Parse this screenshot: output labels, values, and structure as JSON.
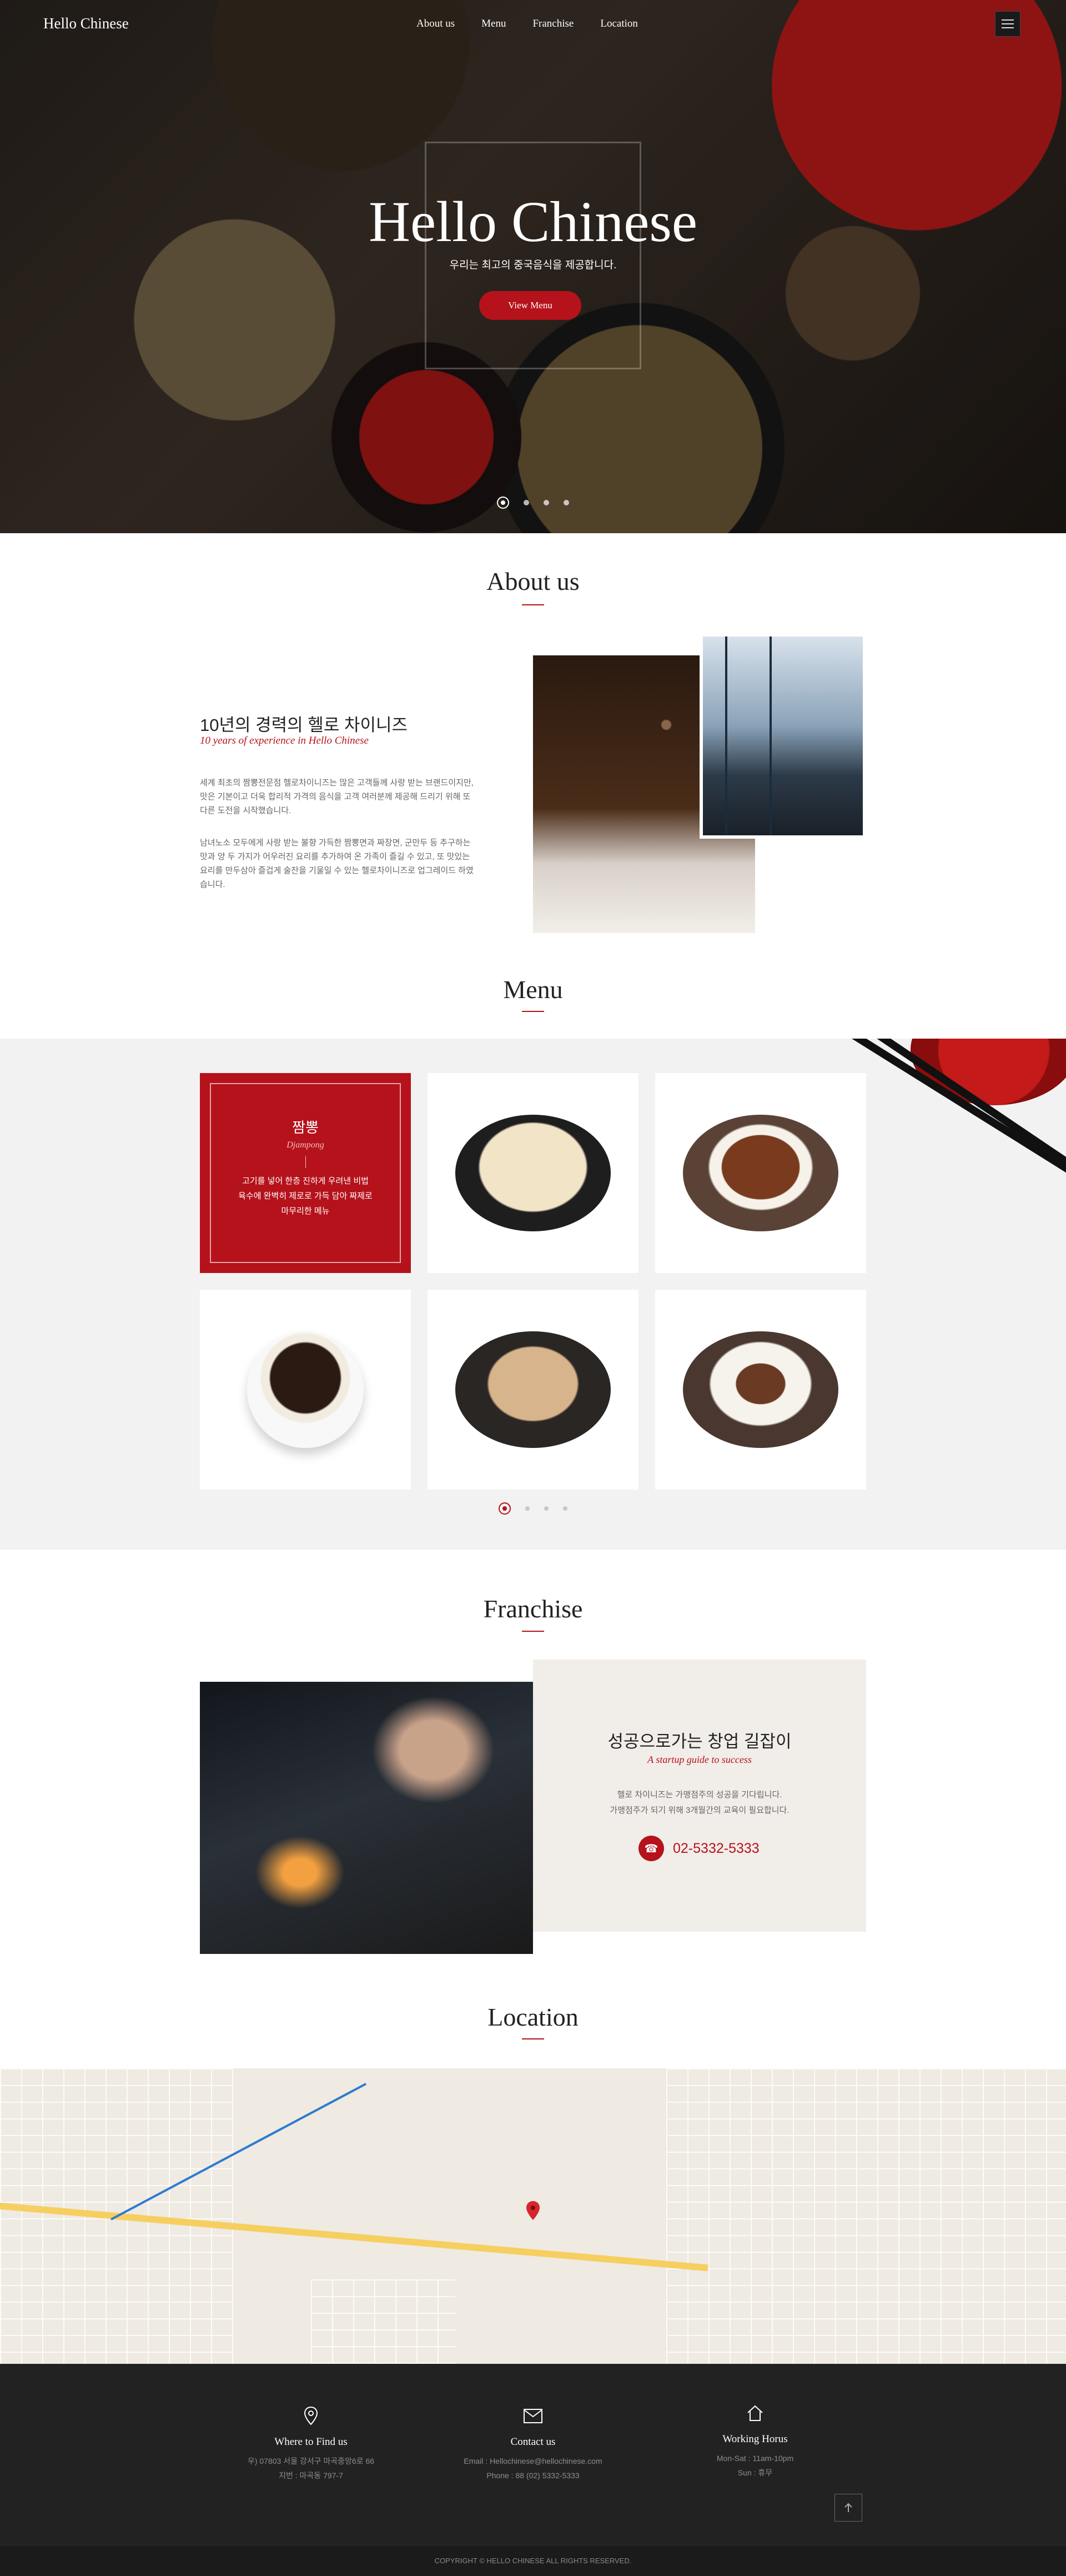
{
  "header": {
    "brand": "Hello Chinese",
    "nav": [
      "About us",
      "Menu",
      "Franchise",
      "Location"
    ]
  },
  "hero": {
    "title": "Hello Chinese",
    "subtitle": "우리는 최고의 중국음식을 제공합니다.",
    "button": "View Menu",
    "slides_total": 4,
    "active_slide": 1
  },
  "about": {
    "section_title": "About us",
    "heading": "10년의 경력의 헬로 차이니즈",
    "heading_en": "10 years of experience in Hello Chinese",
    "para1": "세계 최초의 짬뽕전문점 헬로차이니즈는 많은 고객들께 사랑 받는 브랜드이지만, 맛은 기본이고 더욱 합리적 가격의 음식을 고객 여러분께 제공해 드리기 위해 또 다른 도전을 시작했습니다.",
    "para2": "남녀노소 모두에게 사랑 받는 볼향 가득한 짬뽕면과 짜장면, 군만두 등 추구하는 맛과 양 두 가지가 어우러진 요리를 추가하여 온 가족이 즐길 수 있고, 또 맛있는 요리를 만두삼아 즐겁게 술잔을 기울일 수 있는 헬로차이니즈로 업그레이드 하였습니다."
  },
  "menu": {
    "section_title": "Menu",
    "featured": {
      "name": "짬뽕",
      "name_en": "Djampong",
      "desc": [
        "고기를 넣어 한층 진하게 우려낸 비법",
        "육수에 완벽히 제로로 가득 담아 짜제로",
        "마무리한 메뉴"
      ]
    },
    "items": [
      "fried-dumplings",
      "bulgogi-rice-bowl",
      "jjajang-noodles",
      "chicken-bibimbap",
      "beef-bibimbap"
    ],
    "slides_total": 4,
    "active_slide": 1
  },
  "franchise": {
    "section_title": "Franchise",
    "heading": "성공으로가는 창업 길잡이",
    "heading_en": "A startup guide to success",
    "line1": "헬로 차이니즈는 가맹점주의 성공을 기다립니다.",
    "line2": "가맹점주가 되기 위해 3개월간의 교육이 필요합니다.",
    "phone": "02-5332-5333"
  },
  "location": {
    "section_title": "Location"
  },
  "footer": {
    "where": {
      "title": "Where to Find us",
      "line1": "우) 07803 서울 강서구 마곡중앙6로 66",
      "line2": "지번 : 마곡동 797-7"
    },
    "contact": {
      "title": "Contact us",
      "line1": "Email : Hellochinese@hellochinese.com",
      "line2": "Phone : 88 (02) 5332-5333"
    },
    "hours": {
      "title": "Working Horus",
      "line1": "Mon-Sat : 11am-10pm",
      "line2": "Sun : 휴무"
    },
    "copyright": "COPYRIGHT © HELLO CHINESE ALL RIGHTS RESERVED."
  },
  "colors": {
    "accent": "#b5121b",
    "footer_bg": "#222222",
    "section_bg": "#f2f2f2"
  }
}
